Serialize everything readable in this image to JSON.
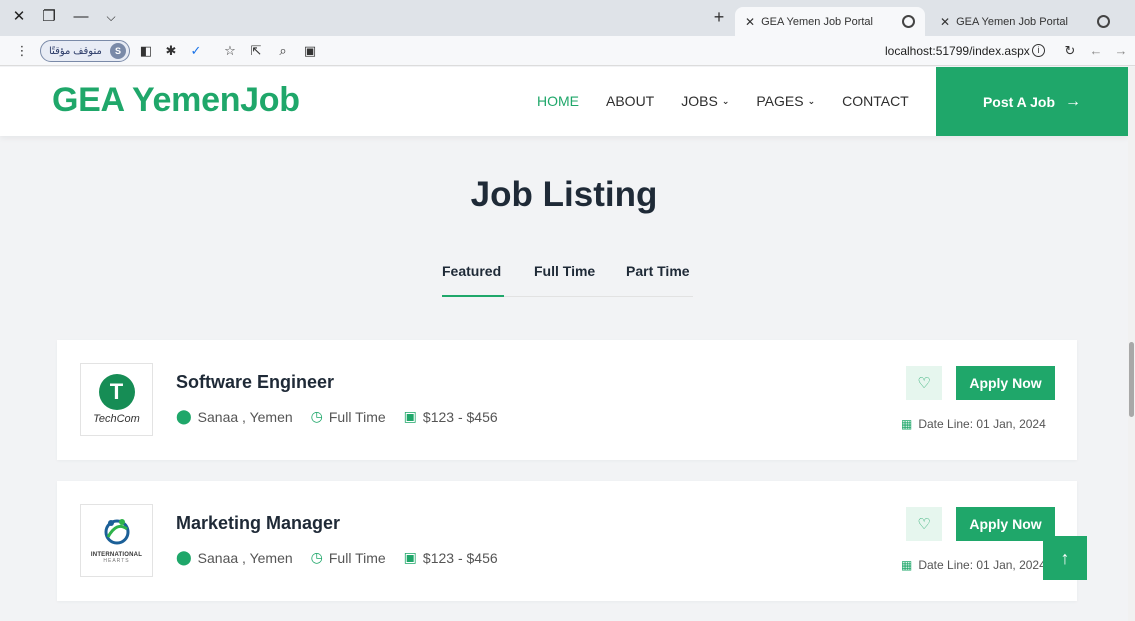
{
  "browser": {
    "tabs": [
      {
        "title": "GEA Yemen Job Portal",
        "active": true
      },
      {
        "title": "GEA Yemen Job Portal",
        "active": false
      }
    ],
    "profile_label": "متوقف مؤقتًا",
    "profile_initial": "S",
    "address": "localhost:51799/index.aspx"
  },
  "site": {
    "logo": "GEA YemenJob",
    "nav": [
      {
        "label": "HOME",
        "active": true,
        "dropdown": false
      },
      {
        "label": "ABOUT",
        "active": false,
        "dropdown": false
      },
      {
        "label": "JOBS",
        "active": false,
        "dropdown": true
      },
      {
        "label": "PAGES",
        "active": false,
        "dropdown": true
      },
      {
        "label": "CONTACT",
        "active": false,
        "dropdown": false
      }
    ],
    "post_job_label": "Post A Job",
    "accent_color": "#1fa76a"
  },
  "listing": {
    "title": "Job Listing",
    "tabs": [
      {
        "label": "Featured",
        "active": true
      },
      {
        "label": "Full Time",
        "active": false
      },
      {
        "label": "Part Time",
        "active": false
      }
    ],
    "jobs": [
      {
        "company_logo": "TechCom",
        "title": "Software Engineer",
        "location": "Sanaa , Yemen",
        "type": "Full Time",
        "salary": "$123 - $456",
        "apply_label": "Apply Now",
        "deadline": "Date Line: 01 Jan, 2024"
      },
      {
        "company_logo": "INTERNATIONAL HEARTS",
        "company_logo_top": "INTERNATIONAL",
        "company_logo_bottom": "HEARTS",
        "title": "Marketing Manager",
        "location": "Sanaa , Yemen",
        "type": "Full Time",
        "salary": "$123 - $456",
        "apply_label": "Apply Now",
        "deadline": "Date Line: 01 Jan, 2024"
      }
    ]
  }
}
